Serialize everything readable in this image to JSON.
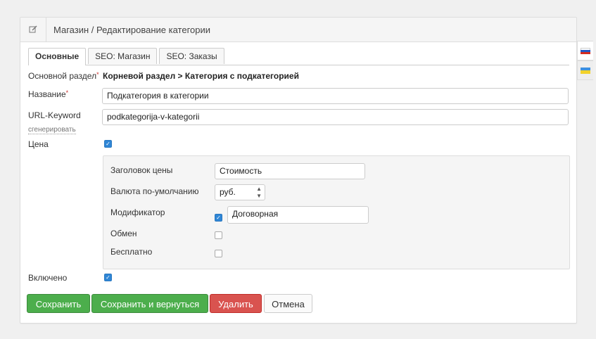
{
  "header": {
    "title": "Магазин / Редактирование категории",
    "icon": "edit-icon"
  },
  "tabs": [
    {
      "label": "Основные",
      "active": true
    },
    {
      "label": "SEO: Магазин",
      "active": false
    },
    {
      "label": "SEO: Заказы",
      "active": false
    }
  ],
  "form": {
    "parent_label": "Основной раздел",
    "parent_value": "Корневой раздел > Категория с подкатегорией",
    "name_label": "Название",
    "name_value": "Подкатегория в категории",
    "url_label": "URL-Keyword",
    "url_generate": "сгенерировать",
    "url_value": "podkategorija-v-kategorii",
    "price_label": "Цена",
    "price_checked": true,
    "enabled_label": "Включено",
    "enabled_checked": true,
    "required_mark": "*"
  },
  "price_settings": {
    "title_label": "Заголовок цены",
    "title_value": "Стоимость",
    "currency_label": "Валюта по-умолчанию",
    "currency_value": "руб.",
    "modifier_label": "Модификатор",
    "modifier_checked": true,
    "modifier_value": "Договорная",
    "exchange_label": "Обмен",
    "exchange_checked": false,
    "free_label": "Бесплатно",
    "free_checked": false
  },
  "buttons": {
    "save": "Сохранить",
    "save_return": "Сохранить и вернуться",
    "delete": "Удалить",
    "cancel": "Отмена"
  },
  "language_flags": [
    "ru-flag-icon",
    "ua-flag-icon"
  ],
  "colors": {
    "green": "#4cae4c",
    "red": "#d9534f",
    "checkbox": "#2f86d6"
  }
}
